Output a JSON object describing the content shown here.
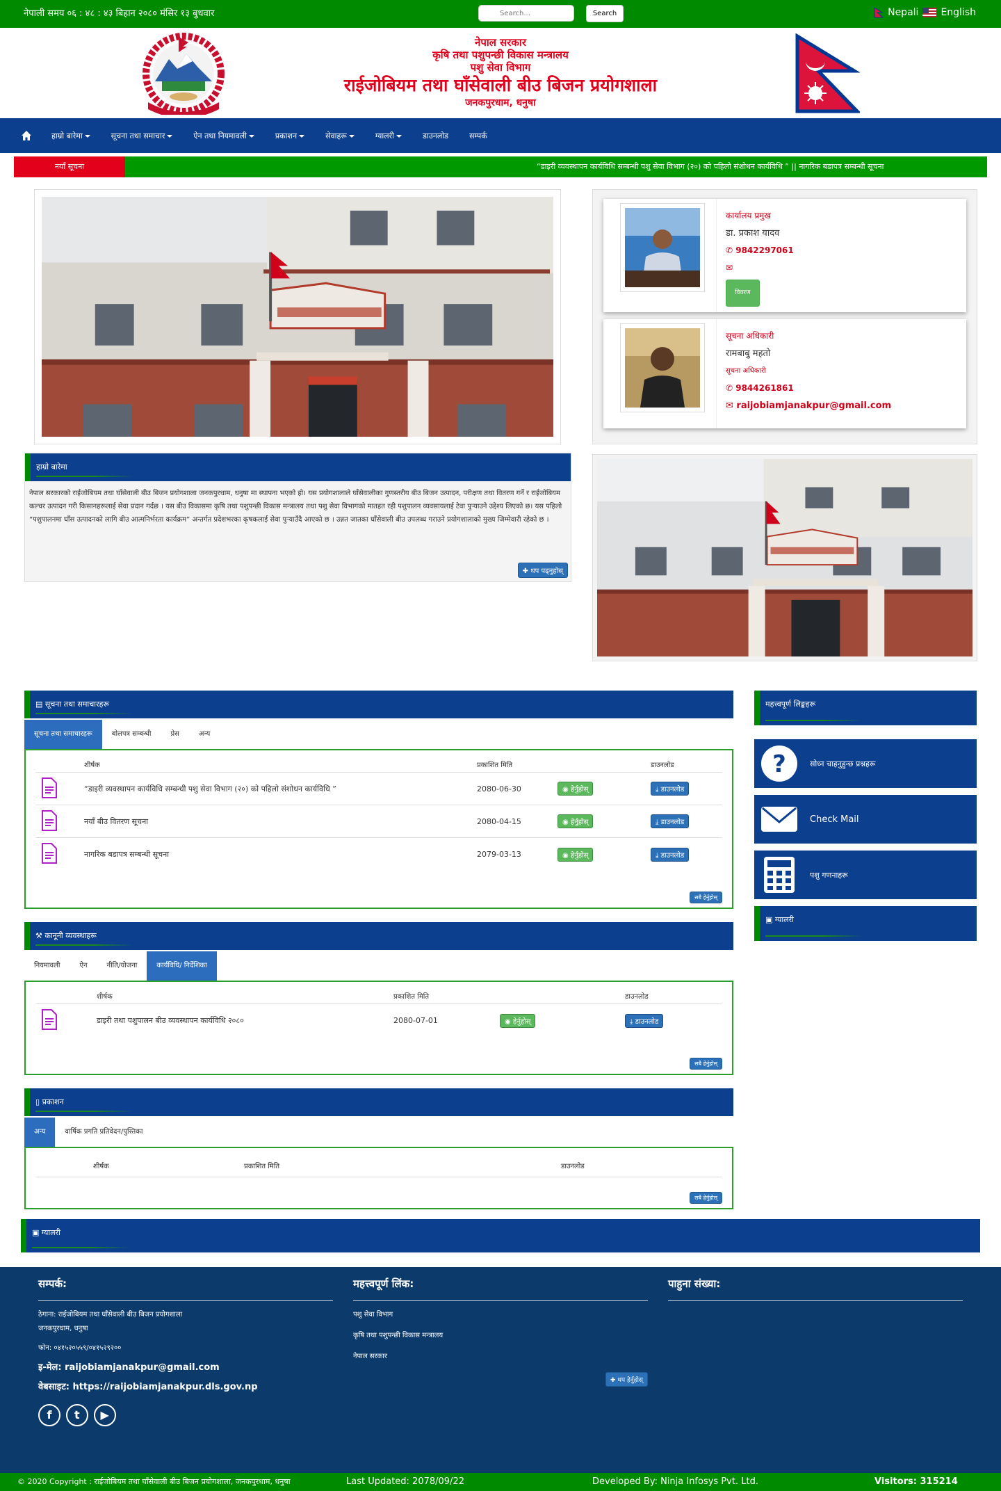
{
  "topbar": {
    "clock": "नेपाली समय ०६ : ४८ : ४३ बिहान   २०८० मंसिर १३ बुधवार",
    "search_placeholder": "Search...",
    "search_button": "Search",
    "lang_nepali": "Nepali",
    "lang_english": "English"
  },
  "header": {
    "line1": "नेपाल सरकार",
    "line2": "कृषि तथा पशुपन्छी विकास मन्त्रालय",
    "line3": "पशु सेवा विभाग",
    "line4": "राईजोबियम तथा घाँसेवाली बीउ बिजन प्रयोगशाला",
    "line5": "जनकपुरधाम, धनुषा"
  },
  "nav": {
    "items": [
      {
        "label": "हाम्रो बारेमा",
        "dropdown": true
      },
      {
        "label": "सूचना तथा समाचार",
        "dropdown": true
      },
      {
        "label": "ऐन तथा नियमावली",
        "dropdown": true
      },
      {
        "label": "प्रकाशन",
        "dropdown": true
      },
      {
        "label": "सेवाहरू",
        "dropdown": true
      },
      {
        "label": "ग्यालरी",
        "dropdown": true
      },
      {
        "label": "डाउनलोड",
        "dropdown": false
      },
      {
        "label": "सम्पर्क",
        "dropdown": false
      }
    ]
  },
  "ticker": {
    "label": "नयाँ सूचना",
    "text": "“डाइरी व्यवस्थापन कार्यविधि सम्बन्धी पशु सेवा विभाग (२०) को पहिलो संशोधन कार्यविधि ”    || नागरिक बडापत्र सम्बन्धी सूचना"
  },
  "intro": {
    "title": "हाम्रो बारेमा",
    "body": "नेपाल सरकारको राईजोबियम तथा घाँसेवाली बीउ बिजन प्रयोगशाला जनकपुरधाम, धनुषा मा स्थापना भएको हो। यस प्रयोगशालाले घाँसेवालीका गुणस्तरीय बीउ बिजन उत्पादन, परीक्षण तथा वितरण गर्ने र राईजोबियम कल्चर उत्पादन गरी किसानहरूलाई सेवा प्रदान गर्दछ । यस बीउ विकासमा कृषि तथा पशुपन्छी विकास मन्त्रालय तथा पशु सेवा विभागको मातहत रही पशुपालन व्यवसायलाई टेवा पुर्‍याउने उद्देश्य लिएको छ। यस पहिलो “पशुपालनमा घाँस उत्पादनको लागि बीउ आत्मनिर्भरता कार्यक्रम” अन्तर्गत प्रदेशभरका कृषकलाई सेवा पुर्‍याउँदै आएको छ । उन्नत जातका घाँसेवाली बीउ उपलब्ध गराउने प्रयोगशालाको मुख्य जिम्मेवारी रहेको छ ।",
    "more": "थप पढ्नुहोस्"
  },
  "staff": [
    {
      "role": "कार्यालय प्रमुख",
      "name": "डा. प्रकाश यादव",
      "phone": "9842297061",
      "email": "",
      "button": "विवरण"
    },
    {
      "role": "सूचना अधिकारी",
      "name": "रामबाबु महतो",
      "title": "सूचना अधिकारी",
      "phone": "9844261861",
      "email": "raijobiamjanakpur@gmail.com"
    }
  ],
  "notices": {
    "title": "सूचना तथा समाचारहरू",
    "tabs": [
      "सूचना तथा समाचारहरू",
      "बोलपत्र सम्बन्धी",
      "प्रेस",
      "अन्य"
    ],
    "active_tab": 0,
    "headers": [
      "शीर्षक",
      "प्रकाशित मिति",
      "",
      "डाउनलोड"
    ],
    "view_label": "हेर्नुहोस्",
    "download_label": "डाउनलोड",
    "rows": [
      {
        "title": "“डाइरी व्यवस्थापन कार्यविधि सम्बन्धी पशु सेवा विभाग (२०) को पहिलो संशोधन कार्यविधि ”",
        "date": "2080-06-30"
      },
      {
        "title": "नयाँ बीउ वितरण सूचना",
        "date": "2080-04-15"
      },
      {
        "title": "नागरिक बडापत्र सम्बन्धी सूचना",
        "date": "2079-03-13"
      }
    ],
    "view_all": "सबै हेर्नुहोस्"
  },
  "acts": {
    "title": "कानूनी व्यवस्थाहरू",
    "tabs": [
      "नियमावली",
      "ऐन",
      "नीति/योजना",
      "कार्यविधि/ निर्देशिका"
    ],
    "active_tab": 3,
    "headers": [
      "शीर्षक",
      "प्रकाशित मिति",
      "",
      "डाउनलोड"
    ],
    "view_label": "हेर्नुहोस्",
    "download_label": "डाउनलोड",
    "rows": [
      {
        "title": "डाइरी तथा पशुपालन बीउ व्यवस्थापन कार्यविधि २०८०",
        "date": "2080-07-01"
      }
    ],
    "view_all": "सबै हेर्नुहोस्"
  },
  "publications": {
    "title": "प्रकाशन",
    "tabs": [
      "अन्य",
      "वार्षिक प्रगति प्रतिवेदन/पुस्तिका"
    ],
    "active_tab": 0,
    "headers": [
      "शीर्षक",
      "प्रकाशित मिति",
      "डाउनलोड"
    ],
    "view_all": "सबै हेर्नुहोस्"
  },
  "gallery_bar": {
    "title": "ग्यालरी"
  },
  "right": {
    "links_title": "महत्त्वपूर्ण लिङ्कहरू",
    "quick": [
      {
        "label": "सोध्न चाहनुहुन्छ प्रश्नहरू",
        "icon": "question-circle-icon"
      },
      {
        "label": "Check Mail",
        "icon": "envelope-icon"
      },
      {
        "label": "पशु गणनाहरू",
        "icon": "calculator-icon"
      }
    ],
    "gallery_title": "ग्यालरी"
  },
  "footer": {
    "contact_title": "सम्पर्क:",
    "address": "ठेगाना: राईजोबियम तथा घाँसेवाली बीउ बिजन प्रयोगशाला",
    "address2": "जनकपुरधाम, धनुषा",
    "phone": "फोन: ०४१५२०५५९/०४१५२९२००",
    "email": "इ-मेल: raijobiamjanakpur@gmail.com",
    "website": "वेबसाइट: https://raijobiamjanakpur.dls.gov.np",
    "links_title": "महत्त्वपूर्ण लिंक:",
    "links": [
      "पशु सेवा विभाग",
      "कृषि तथा पशुपन्छी विकास मन्त्रालय",
      "नेपाल सरकार"
    ],
    "links_more": "थप हेर्नुहोस्",
    "visitors_title": "पाहुना संख्या:"
  },
  "copyright": {
    "text": "© 2020 Copyright : राईजोबियम तथा घाँसेवाली बीउ बिजन प्रयोगशाला, जनकपुरधाम, धनुषा",
    "updated": "Last Updated: 2078/09/22",
    "developed": "Developed By: Ninja Infosys Pvt. Ltd.",
    "visitors": "Visitors: 315214"
  }
}
